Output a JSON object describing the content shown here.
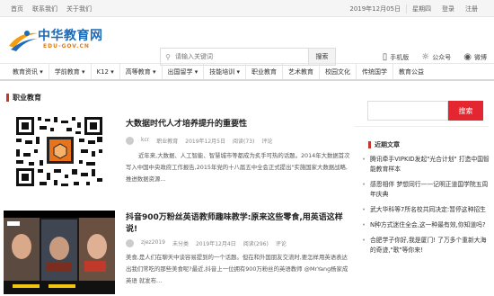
{
  "topbar": {
    "left": [
      "首页",
      "联系我们",
      "关于我们"
    ],
    "right": [
      "2019年12月05日",
      "星期四",
      "登录",
      "注册"
    ]
  },
  "logo": {
    "cn": "中华教育网",
    "en": "EDU-GOV.CN"
  },
  "search": {
    "placeholder": "请输入关键词",
    "button": "搜索"
  },
  "header_links": [
    {
      "label": "手机版",
      "icon": "phone-icon"
    },
    {
      "label": "公众号",
      "icon": "wechat-icon"
    },
    {
      "label": "微博",
      "icon": "weibo-icon"
    }
  ],
  "nav": [
    "教育资讯",
    "学前教育",
    "K12",
    "高等教育",
    "出国留学",
    "技能培训",
    "职业教育",
    "艺术教育",
    "校园文化",
    "传统国学",
    "教育公益"
  ],
  "section_title": "职业教育",
  "articles": [
    {
      "title": "大数据时代人才培养提升的重要性",
      "author": "kcr",
      "category": "职业教育",
      "date": "2019年12月5日",
      "views": "阅读(73)",
      "comments": "评论",
      "summary": "近年来,大数据、人工智能、智慧城市等都成为炙手可热的话题。2014年大数据首次写入中国中央政府工作报告,2015年党的十八届五中全会正式提出\"实施国家大数据战略,推进数据资源…"
    },
    {
      "title": "抖音900万粉丝英语教师趣味教学:原来这些零食,用英语这样说!",
      "author": "zjez2019",
      "category": "未分类",
      "date": "2019年12月4日",
      "views": "阅读(296)",
      "comments": "评论",
      "summary": "美食,是人们在聊天中谈容易提到的一个话题。但在和外国朋友交流时,要怎样用英语表达出我们常吃的那些美食呢?最近,抖音上一位拥有900万粉丝的英语教师 @MrYang杨家成英语 就发布…"
    }
  ],
  "sidebar": {
    "search_button": "搜索",
    "recent_title": "近期文章",
    "recent": [
      "腾讯牵手VIPKID发起\"光合计划\" 打造中国智能教育样本",
      "感恩相伴 梦想同行——记明正道国学院五周年庆典",
      "武大华科等7所名校共同决定:暂停这种招生",
      "N种方式迷住全会,这一种最有效,你知道吗?",
      "合肥学子你好,我是厦门! 了万多个重新大海的奇迹,\"歌\"等你来!"
    ]
  }
}
